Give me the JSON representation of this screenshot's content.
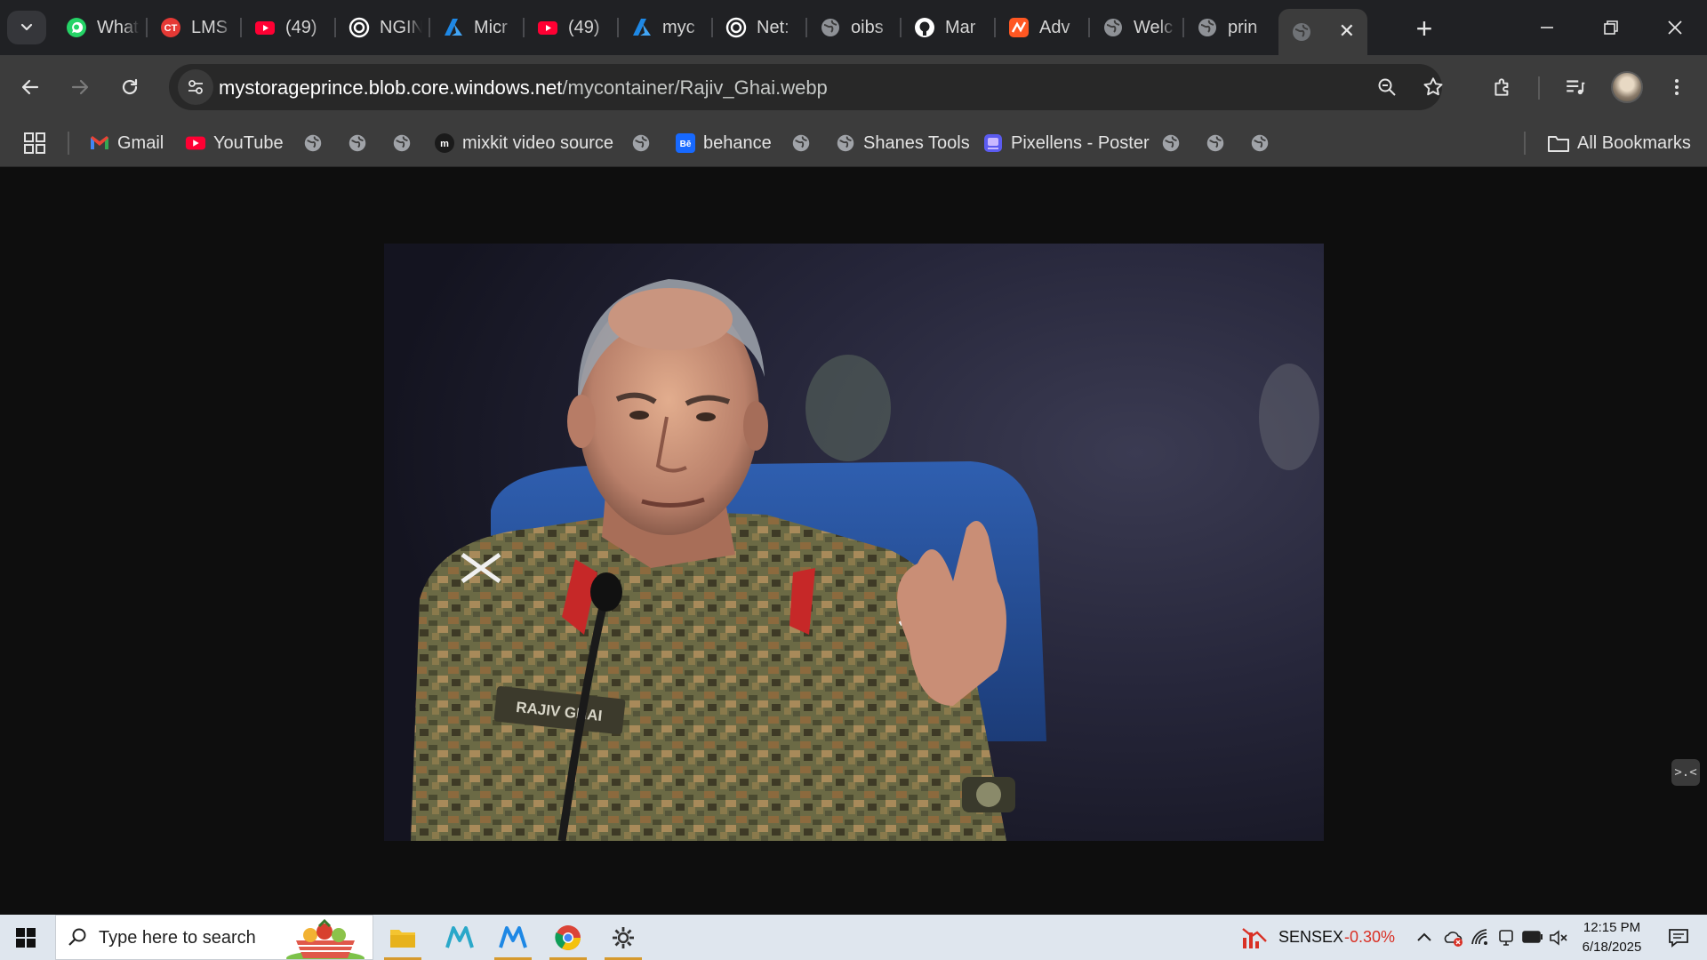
{
  "browser": {
    "tabs": [
      {
        "title": "WhatsApp",
        "icon": "whatsapp-icon"
      },
      {
        "title": "LMS",
        "icon": "lms-icon"
      },
      {
        "title": "(49)",
        "icon": "youtube-icon"
      },
      {
        "title": "NGIN",
        "icon": "openai-icon"
      },
      {
        "title": "Micr",
        "icon": "azure-icon"
      },
      {
        "title": "(49)",
        "icon": "youtube-icon"
      },
      {
        "title": "myc",
        "icon": "azure-icon"
      },
      {
        "title": "Net:",
        "icon": "openai-icon"
      },
      {
        "title": "oibs",
        "icon": "globe-icon"
      },
      {
        "title": "Mar",
        "icon": "github-icon"
      },
      {
        "title": "Adv",
        "icon": "app-icon"
      },
      {
        "title": "Welc",
        "icon": "globe-icon"
      },
      {
        "title": "prin",
        "icon": "globe-icon"
      }
    ],
    "active_tab": {
      "icon": "globe-icon"
    },
    "address": {
      "host": "mystorageprince.blob.core.windows.net",
      "path": "/mycontainer/Rajiv_Ghai.webp"
    },
    "bookmarks": [
      {
        "label": "Gmail",
        "icon": "gmail-icon"
      },
      {
        "label": "YouTube",
        "icon": "youtube-icon"
      },
      {
        "label": "",
        "icon": "globe-icon"
      },
      {
        "label": "",
        "icon": "globe-icon"
      },
      {
        "label": "",
        "icon": "globe-icon"
      },
      {
        "label": "mixkit video source",
        "icon": "mixkit-icon"
      },
      {
        "label": "",
        "icon": "globe-icon"
      },
      {
        "label": "behance",
        "icon": "behance-icon"
      },
      {
        "label": "",
        "icon": "globe-icon"
      },
      {
        "label": "Shanes Tools",
        "icon": "globe-icon"
      },
      {
        "label": "Pixellens - Poster",
        "icon": "pixellens-icon"
      },
      {
        "label": "",
        "icon": "globe-icon"
      },
      {
        "label": "",
        "icon": "globe-icon"
      },
      {
        "label": "",
        "icon": "globe-icon"
      }
    ],
    "all_bookmarks": "All Bookmarks"
  },
  "content": {
    "image_name_tag": "RAJIV GHAI",
    "side_pill_label": ">.<"
  },
  "taskbar": {
    "search_placeholder": "Type here to search",
    "stock_name": "SENSEX",
    "stock_change": "-0.30%",
    "time": "12:15 PM",
    "date": "6/18/2025"
  },
  "colors": {
    "tabstrip": "#202124",
    "toolbar": "#3c3c3c",
    "stock_down": "#d93025",
    "taskbar": "#dfe6ee"
  }
}
